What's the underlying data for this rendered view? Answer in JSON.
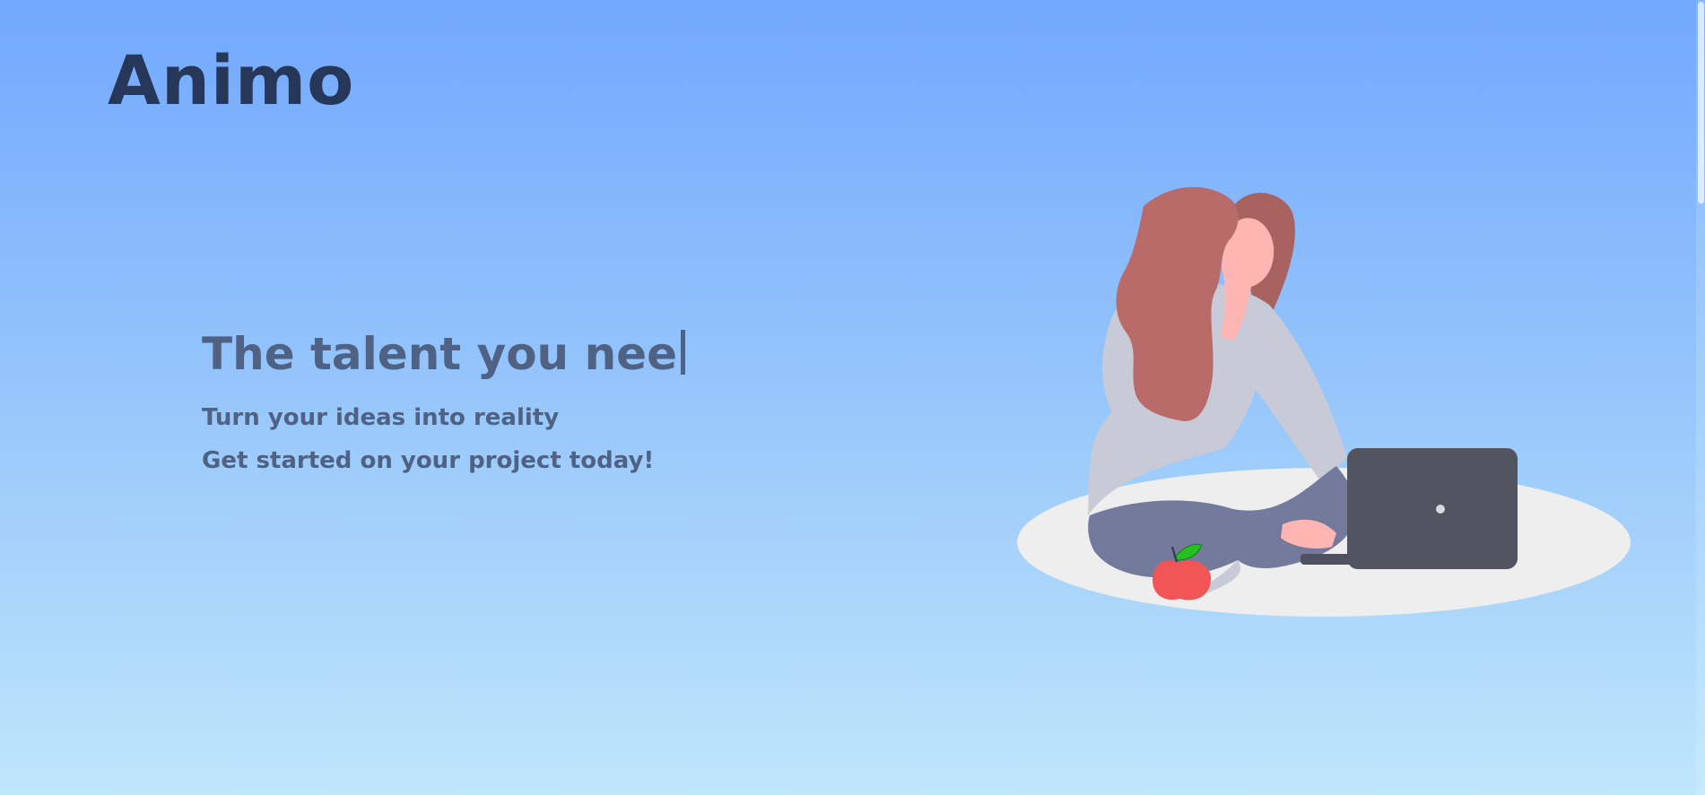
{
  "brand": {
    "logo_text": "Animo"
  },
  "hero": {
    "headline": "The talent you nee",
    "tagline_1": "Turn your ideas into reality",
    "tagline_2": "Get started on your project today!"
  },
  "colors": {
    "background_top": "#72a8fe",
    "background_bottom": "#bfe6fb",
    "logo": "#26375a",
    "text": "#4f6283"
  }
}
